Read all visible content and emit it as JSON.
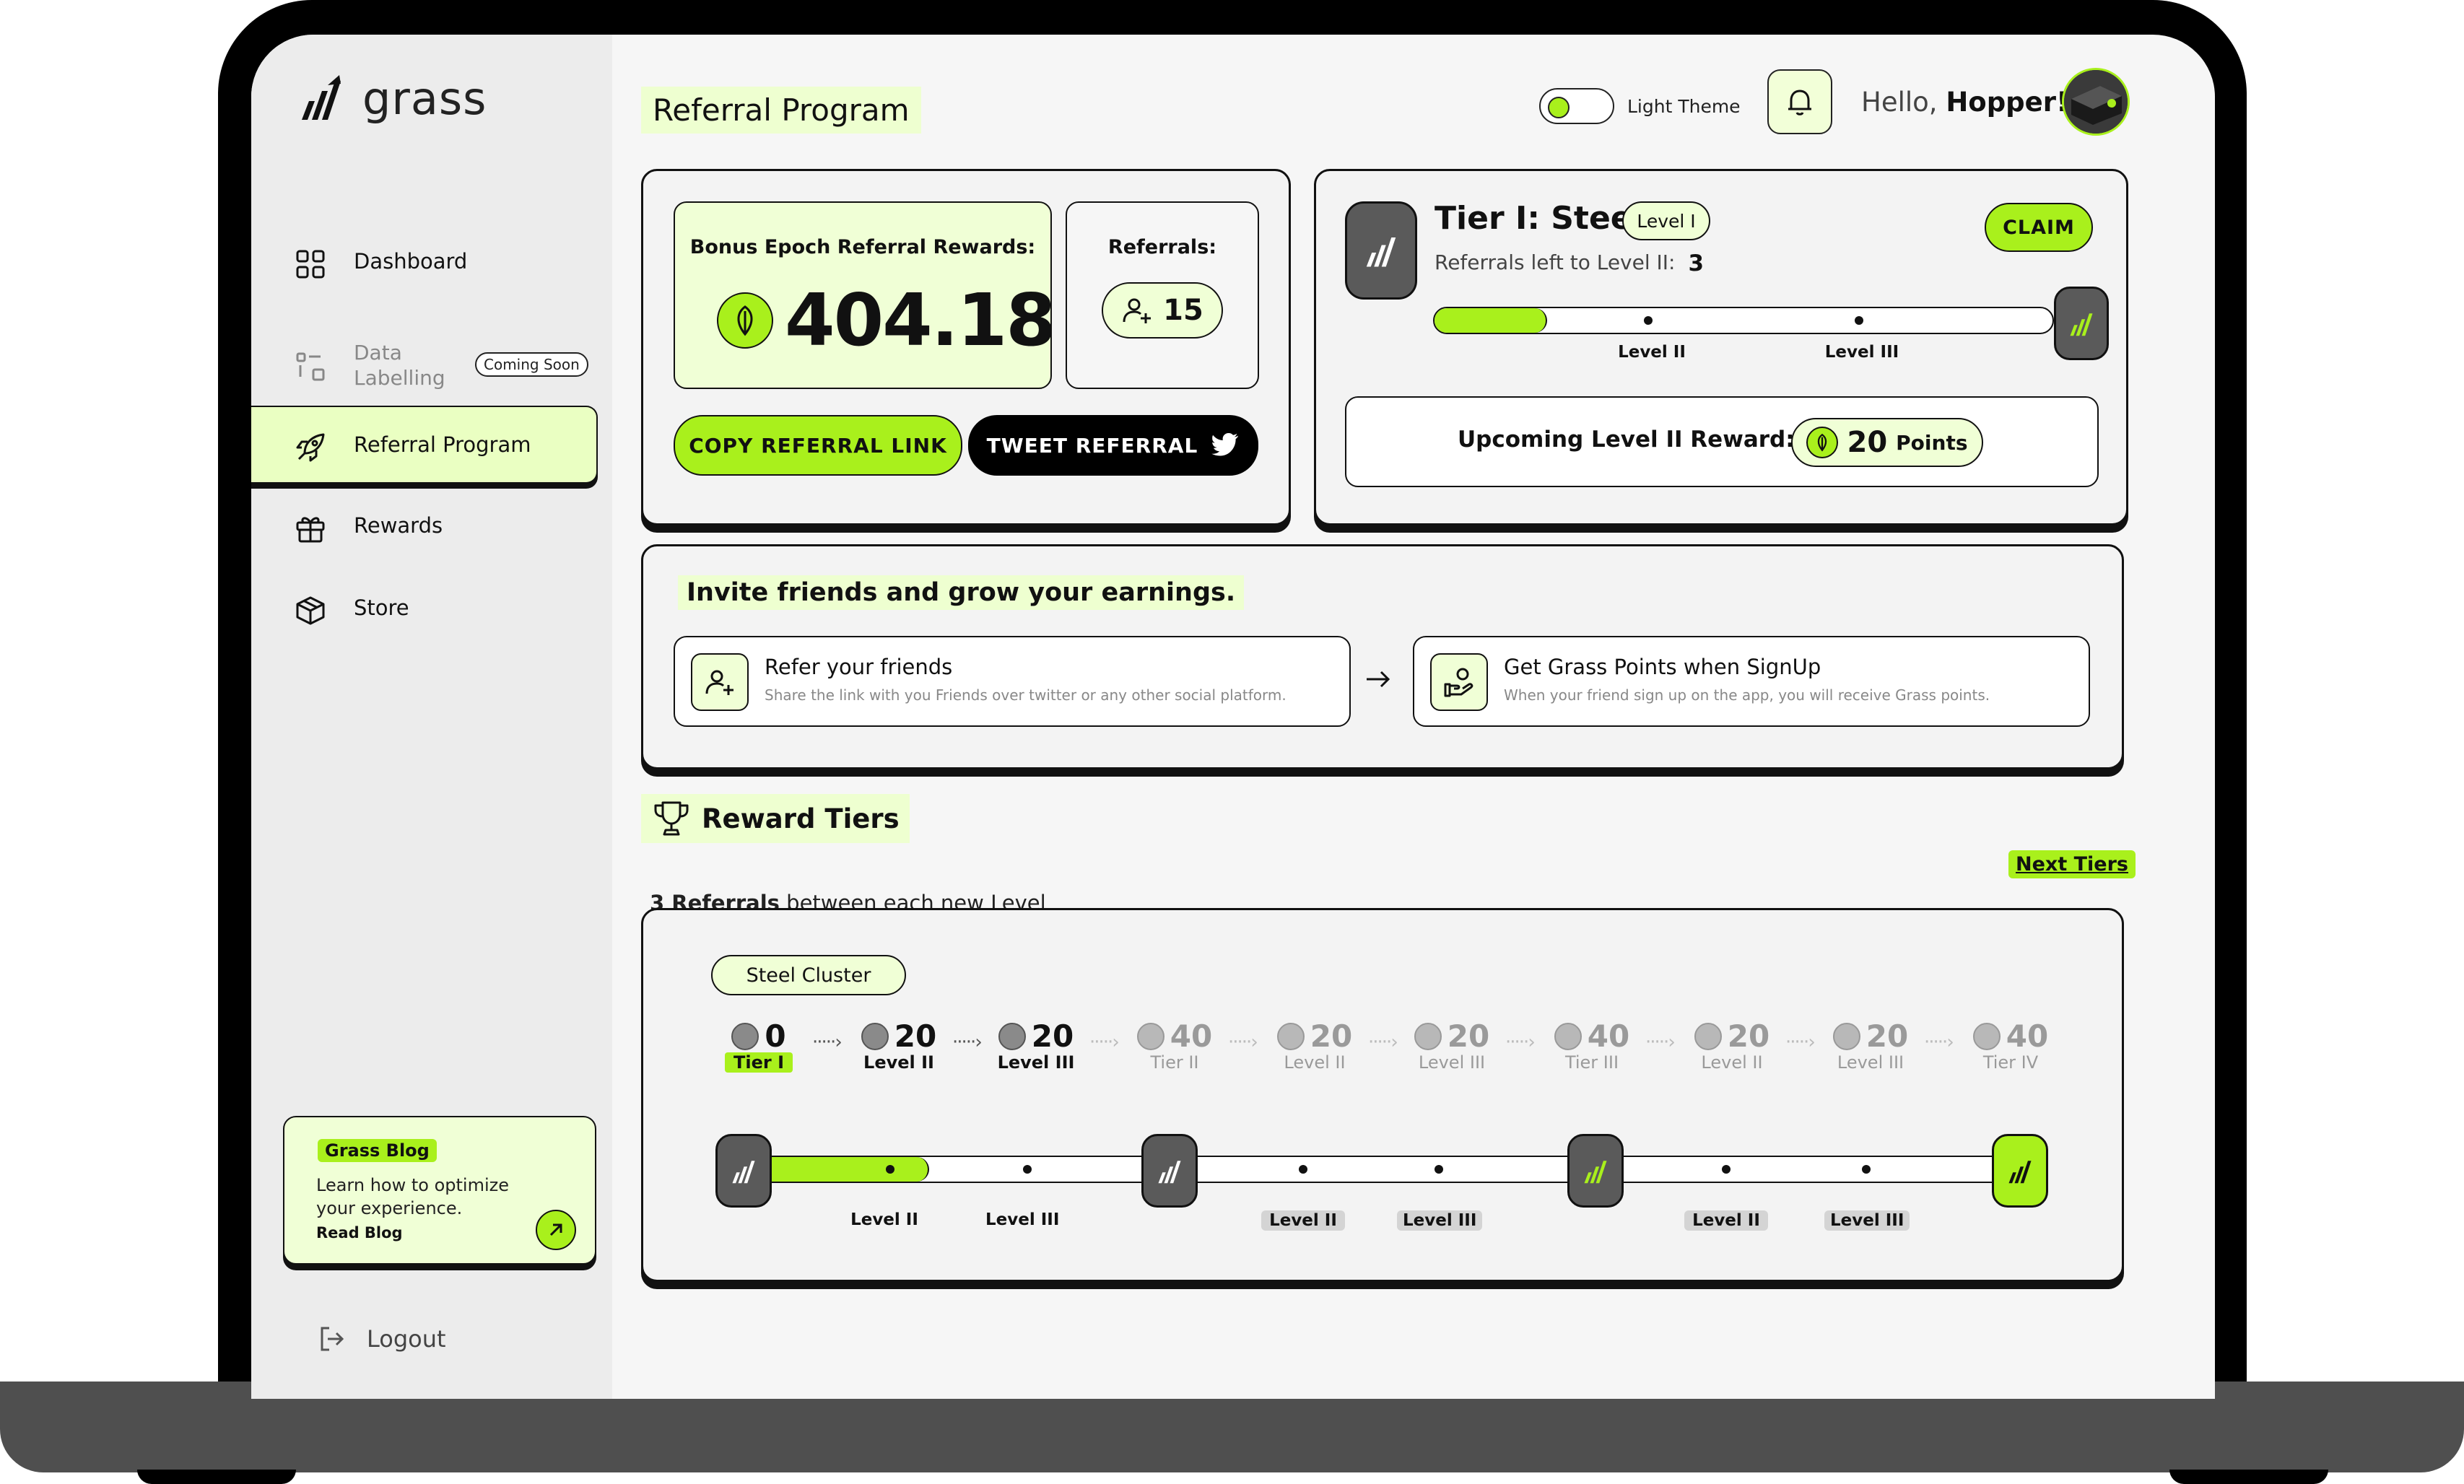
{
  "app": {
    "name": "grass"
  },
  "sidebar": {
    "items": [
      {
        "label": "Dashboard",
        "icon": "grid-icon"
      },
      {
        "label": "Data\nLabelling",
        "icon": "data-labelling-icon",
        "badge": "Coming Soon"
      },
      {
        "label": "Referral Program",
        "icon": "rocket-icon"
      },
      {
        "label": "Rewards",
        "icon": "gift-icon"
      },
      {
        "label": "Store",
        "icon": "box-icon"
      }
    ],
    "blog": {
      "tag": "Grass Blog",
      "text": "Learn how to optimize your experience.",
      "link": "Read Blog"
    },
    "logout": "Logout"
  },
  "header": {
    "title": "Referral Program",
    "theme_label": "Light Theme",
    "greeting": "Hello,",
    "user": "Hopper!"
  },
  "bonus": {
    "label": "Bonus Epoch Referral Rewards:",
    "value": "404.18",
    "referrals_label": "Referrals:",
    "referrals_count": "15",
    "copy_button": "COPY REFERRAL LINK",
    "tweet_button": "TWEET REFERRAL"
  },
  "tier": {
    "title": "Tier I: Steel",
    "level_badge": "Level I",
    "claim": "CLAIM",
    "left_label": "Referrals left to Level II:",
    "left_value": "3",
    "progress": 0.18,
    "markers": [
      "Level II",
      "Level III"
    ],
    "upcoming_label": "Upcoming Level II Reward:",
    "upcoming_value": "20",
    "upcoming_unit": "Points"
  },
  "invite": {
    "title": "Invite friends and grow your earnings.",
    "steps": [
      {
        "title": "Refer your friends",
        "desc": "Share the link with you Friends over twitter or any other social platform."
      },
      {
        "title": "Get Grass Points when SignUp",
        "desc": "When your friend sign up on the app, you will receive Grass points."
      }
    ]
  },
  "reward_tiers": {
    "title": "Reward Tiers",
    "subtitle_bold": "3 Referrals",
    "subtitle_rest": " between each new Level",
    "next": "Next Tiers",
    "cluster": "Steel Cluster",
    "steps": [
      {
        "value": "0",
        "name": "Tier I",
        "active": true
      },
      {
        "value": "20",
        "name": "Level II",
        "active": true
      },
      {
        "value": "20",
        "name": "Level III",
        "active": true
      },
      {
        "value": "40",
        "name": "Tier II",
        "active": false
      },
      {
        "value": "20",
        "name": "Level II",
        "active": false
      },
      {
        "value": "20",
        "name": "Level III",
        "active": false
      },
      {
        "value": "40",
        "name": "Tier III",
        "active": false
      },
      {
        "value": "20",
        "name": "Level II",
        "active": false
      },
      {
        "value": "20",
        "name": "Level III",
        "active": false
      },
      {
        "value": "40",
        "name": "Tier IV",
        "active": false
      }
    ],
    "track_levels": [
      "Level II",
      "Level III",
      "Level II",
      "Level III",
      "Level II",
      "Level III"
    ],
    "progress": 0.14
  },
  "colors": {
    "accent": "#a9f01c",
    "dark": "#111111",
    "light_accent": "#eaffc2"
  }
}
